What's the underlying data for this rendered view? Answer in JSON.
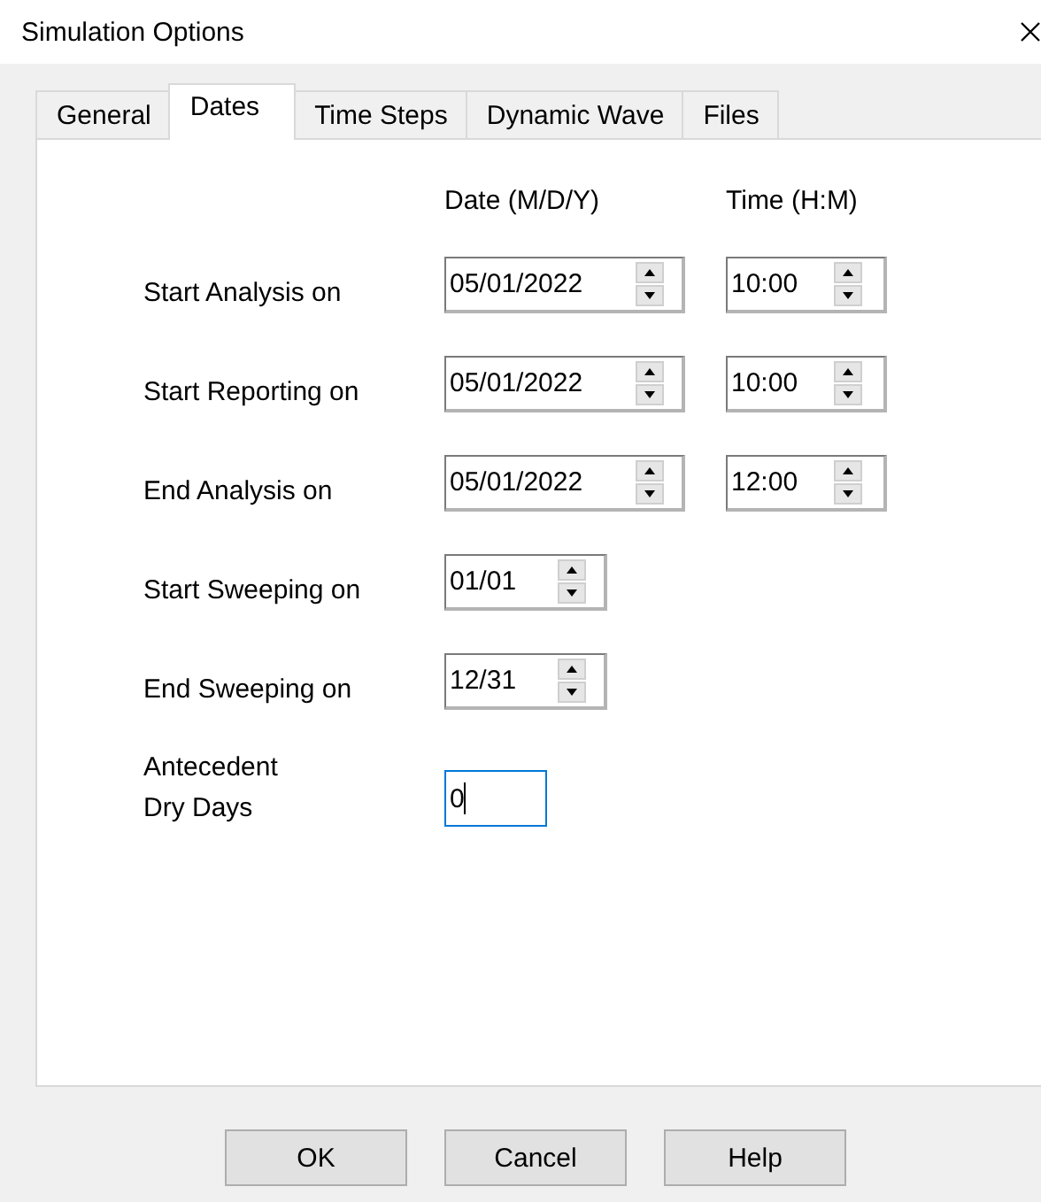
{
  "window": {
    "title": "Simulation Options"
  },
  "tabs": [
    {
      "label": "General",
      "selected": false
    },
    {
      "label": "Dates",
      "selected": true
    },
    {
      "label": "Time Steps",
      "selected": false
    },
    {
      "label": "Dynamic Wave",
      "selected": false
    },
    {
      "label": "Files",
      "selected": false
    }
  ],
  "columns": [
    "Date (M/D/Y)",
    "Time (H:M)"
  ],
  "rows": [
    {
      "kind": "datetime",
      "label": "Start Analysis on",
      "date": "05/01/2022",
      "time": "10:00",
      "focused": false
    },
    {
      "kind": "datetime",
      "label": "Start Reporting on",
      "date": "05/01/2022",
      "time": "10:00",
      "focused": false
    },
    {
      "kind": "datetime",
      "label": "End Analysis on",
      "date": "05/01/2022",
      "time": "12:00",
      "focused": false
    },
    {
      "kind": "day",
      "label": "Start Sweeping on",
      "date": "01/01",
      "focused": false
    },
    {
      "kind": "day",
      "label": "End Sweeping on",
      "date": "12/31",
      "focused": false
    },
    {
      "kind": "number",
      "label": "Antecedent\nDry Days",
      "value": "0",
      "focused": true
    }
  ],
  "buttons": [
    "OK",
    "Cancel",
    "Help"
  ]
}
